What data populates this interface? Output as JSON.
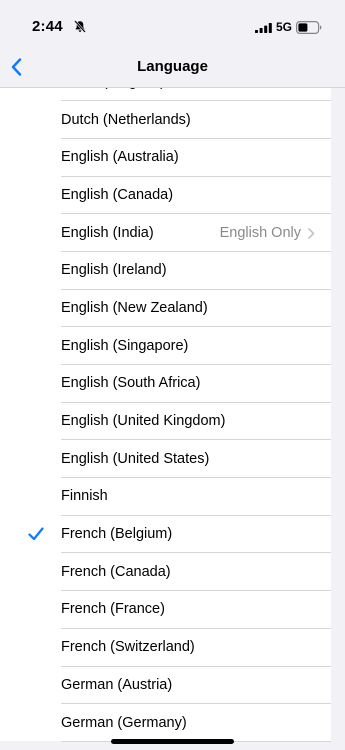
{
  "status_bar": {
    "time": "2:44",
    "network": "5G"
  },
  "nav": {
    "title": "Language"
  },
  "languages": [
    {
      "label": "Dutch (Belgium)",
      "detail": "",
      "selected": false
    },
    {
      "label": "Dutch (Netherlands)",
      "detail": "",
      "selected": false
    },
    {
      "label": "English (Australia)",
      "detail": "",
      "selected": false
    },
    {
      "label": "English (Canada)",
      "detail": "",
      "selected": false
    },
    {
      "label": "English (India)",
      "detail": "English Only",
      "selected": false
    },
    {
      "label": "English (Ireland)",
      "detail": "",
      "selected": false
    },
    {
      "label": "English (New Zealand)",
      "detail": "",
      "selected": false
    },
    {
      "label": "English (Singapore)",
      "detail": "",
      "selected": false
    },
    {
      "label": "English (South Africa)",
      "detail": "",
      "selected": false
    },
    {
      "label": "English (United Kingdom)",
      "detail": "",
      "selected": false
    },
    {
      "label": "English (United States)",
      "detail": "",
      "selected": false
    },
    {
      "label": "Finnish",
      "detail": "",
      "selected": false
    },
    {
      "label": "French (Belgium)",
      "detail": "",
      "selected": true
    },
    {
      "label": "French (Canada)",
      "detail": "",
      "selected": false
    },
    {
      "label": "French (France)",
      "detail": "",
      "selected": false
    },
    {
      "label": "French (Switzerland)",
      "detail": "",
      "selected": false
    },
    {
      "label": "German (Austria)",
      "detail": "",
      "selected": false
    },
    {
      "label": "German (Germany)",
      "detail": "",
      "selected": false
    }
  ],
  "colors": {
    "accent": "#0a7aff",
    "background": "#f2f1f6",
    "secondary_text": "#8a8a8e"
  },
  "icons": {
    "back": "chevron-left-icon",
    "selected": "checkmark-icon",
    "disclosure": "chevron-right-icon",
    "silent": "bell-slash-icon",
    "signal": "cellular-signal-icon",
    "battery": "battery-icon"
  }
}
